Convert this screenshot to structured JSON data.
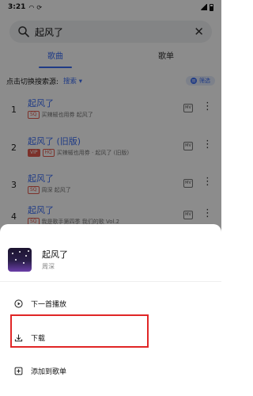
{
  "status_bar": {
    "time": "3:21",
    "icons": [
      "headset-icon",
      "sync-icon"
    ]
  },
  "search": {
    "value": "起风了"
  },
  "tabs": [
    {
      "label": "歌曲",
      "active": true
    },
    {
      "label": "歌单",
      "active": false
    }
  ],
  "source_bar": {
    "label": "点击切换搜索源:",
    "source": "搜索",
    "filter": "筛选"
  },
  "results": [
    {
      "num": "1",
      "title": "起风了",
      "badges": [
        "SQ"
      ],
      "meta": "买辣椒也用券 起风了"
    },
    {
      "num": "2",
      "title": "起风了 (旧版)",
      "badges": [
        "VIP",
        "HQ"
      ],
      "meta": "买辣椒也用券 · 起风了 (旧版)"
    },
    {
      "num": "3",
      "title": "起风了",
      "badges": [
        "SQ"
      ],
      "meta": "周深 起风了"
    },
    {
      "num": "4",
      "title": "起风了",
      "badges": [
        "SQ"
      ],
      "meta": "我是歌手第四季 我们的歌 Vol.2"
    }
  ],
  "accent_color": "#3a6cf4",
  "bottom_sheet": {
    "song_title": "起风了",
    "artist": "周深",
    "options": [
      {
        "label": "下一首播放",
        "icon": "play-next-icon"
      },
      {
        "label": "下载",
        "icon": "download-icon"
      },
      {
        "label": "添加到歌单",
        "icon": "add-to-playlist-icon"
      }
    ]
  }
}
